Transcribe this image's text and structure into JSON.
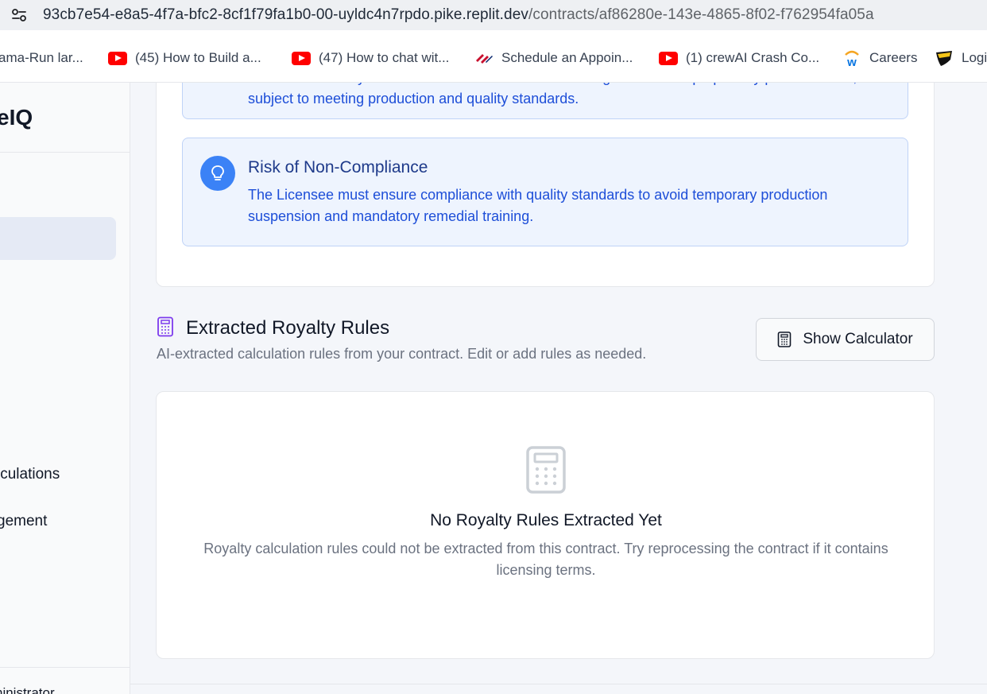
{
  "browser": {
    "url_host": "93cb7e54-e8a5-4f7a-bfc2-8cf1f79fa1b0-00-uyldc4n7rpdo.pike.replit.dev",
    "url_path": "/contracts/af86280e-143e-4865-8f02-f762954fa05a",
    "bookmarks": [
      {
        "label": "ama-Run lar...",
        "icon": "none"
      },
      {
        "label": "(45) How to Build a...",
        "icon": "youtube-icon"
      },
      {
        "label": "(47) How to chat wit...",
        "icon": "youtube-icon"
      },
      {
        "label": "Schedule an Appoin...",
        "icon": "bank-flag-icon"
      },
      {
        "label": "(1) crewAI Crash Co...",
        "icon": "youtube-icon"
      },
      {
        "label": "Careers",
        "icon": "workday-icon"
      },
      {
        "label": "Logi",
        "icon": "shield-icon"
      }
    ]
  },
  "sidebar": {
    "brand": "eIQ",
    "item_top": "",
    "item_calculations": "lculations",
    "item_management": "gement",
    "user_role": "ninistrator"
  },
  "insights": [
    {
      "text": "The Licensee may benefit from increased revenue through the sale of proprietary plant varieties, subject to meeting production and quality standards."
    },
    {
      "title": "Risk of Non-Compliance",
      "text": "The Licensee must ensure compliance with quality standards to avoid temporary production suspension and mandatory remedial training."
    }
  ],
  "royalty": {
    "title": "Extracted Royalty Rules",
    "subtitle": "AI-extracted calculation rules from your contract. Edit or add rules as needed.",
    "calc_button": "Show Calculator",
    "empty_title": "No Royalty Rules Extracted Yet",
    "empty_desc": "Royalty calculation rules could not be extracted from this contract. Try reprocessing the contract if it contains licensing terms."
  },
  "colors": {
    "accent_blue": "#3b82f6",
    "insight_bg": "#eef4fe",
    "insight_text": "#1d4ed8",
    "section_icon": "#7c3aed"
  }
}
